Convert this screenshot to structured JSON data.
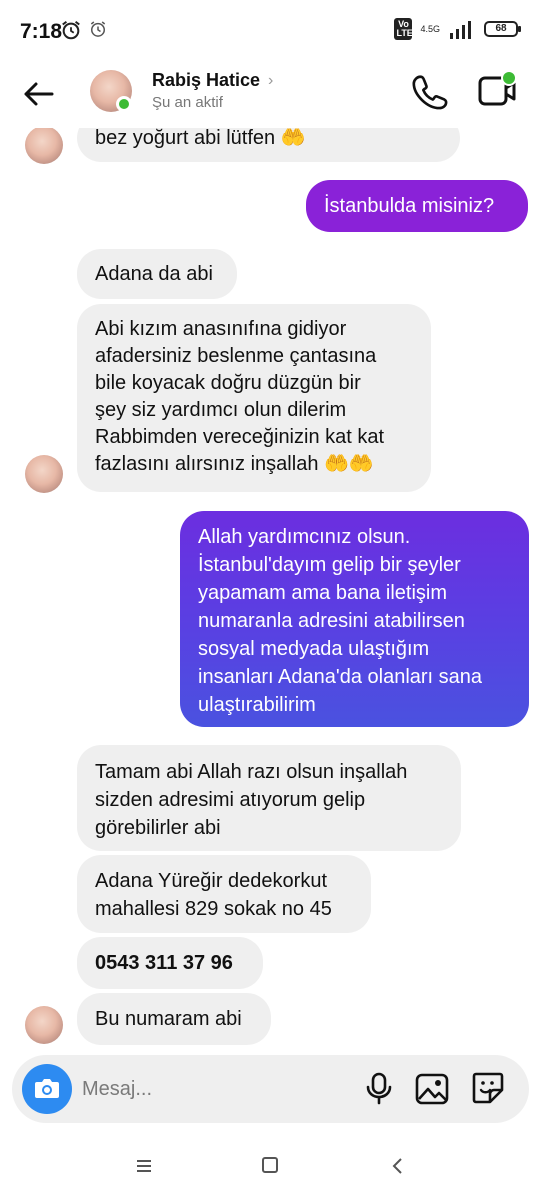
{
  "status_bar": {
    "time": "7:18",
    "network_badge": "Vo LTE",
    "network_type": "4.5G",
    "battery": "68"
  },
  "header": {
    "contact_name": "Rabiş Hatice",
    "contact_status": "Şu an aktif"
  },
  "messages": [
    {
      "side": "left",
      "lines": [
        "bez yoğurt abi lütfen 🤲"
      ]
    },
    {
      "side": "right",
      "lines": [
        "İstanbulda misiniz?"
      ]
    },
    {
      "side": "left",
      "lines": [
        "Adana da abi"
      ]
    },
    {
      "side": "left",
      "lines": [
        "Abi kızım anasınıfına gidiyor",
        "afadersiniz beslenme çantasına",
        "bile koyacak doğru düzgün bir",
        "şey siz yardımcı olun dilerim",
        "Rabbimden vereceğinizin kat kat",
        "fazlasını alırsınız inşallah 🤲🤲"
      ]
    },
    {
      "side": "right",
      "lines": [
        "Allah yardımcınız olsun.",
        "İstanbul'dayım gelip bir şeyler",
        "yapamam ama bana iletişim",
        "numaranla adresini atabilirsen",
        "sosyal medyada ulaştığım",
        "insanları Adana'da olanları sana",
        "ulaştırabilirim"
      ]
    },
    {
      "side": "left",
      "lines": [
        "Tamam abi Allah razı olsun inşallah",
        "sizden adresimi atıyorum gelip",
        "görebilirler abi"
      ]
    },
    {
      "side": "left",
      "lines": [
        "Adana Yüreğir dedekorkut",
        "mahallesi 829 sokak no 45"
      ]
    },
    {
      "side": "left",
      "lines": [
        "0543 311 37 96"
      ],
      "bold": true
    },
    {
      "side": "left",
      "lines": [
        "Bu numaram abi"
      ]
    }
  ],
  "composer": {
    "placeholder": "Mesaj..."
  },
  "colors": {
    "accent_blue": "#2d8bf1",
    "online_green": "#3dbb35",
    "bubble_purple": "#8a22d8",
    "bubble_indigo": "#4b4fe0",
    "received_bubble": "#efefef"
  },
  "icons": [
    "back-arrow-icon",
    "chevron-right-icon",
    "phone-icon",
    "video-icon",
    "camera-icon",
    "microphone-icon",
    "gallery-icon",
    "sticker-icon",
    "menu-icon",
    "home-icon",
    "nav-back-icon",
    "alarm-clock-icon",
    "signal-icon",
    "battery-icon"
  ]
}
